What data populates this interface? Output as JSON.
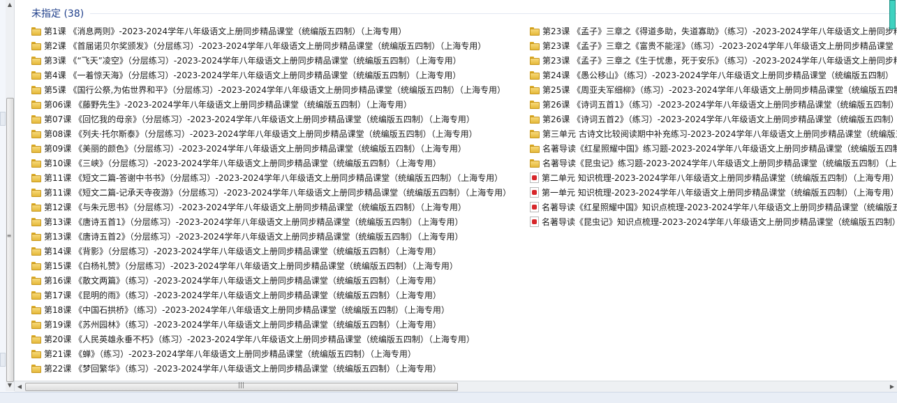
{
  "group": {
    "title": "未指定 (38)"
  },
  "column1": [
    {
      "icon": "folder-icon",
      "label": "第1课 《消息两则》-2023-2024学年八年级语文上册同步精品课堂（统编版五四制）（上海专用）"
    },
    {
      "icon": "folder-icon",
      "label": "第2课 《首届诺贝尔奖颁发》（分层练习）-2023-2024学年八年级语文上册同步精品课堂（统编版五四制）（上海专用）"
    },
    {
      "icon": "folder-icon",
      "label": "第3课 《“飞天”凌空》（分层练习）-2023-2024学年八年级语文上册同步精品课堂（统编版五四制）（上海专用）"
    },
    {
      "icon": "folder-icon",
      "label": "第4课 《一着惊天海》（分层练习）-2023-2024学年八年级语文上册同步精品课堂（统编版五四制）（上海专用）"
    },
    {
      "icon": "folder-icon",
      "label": "第5课 《国行公祭,为佑世界和平》（分层练习）-2023-2024学年八年级语文上册同步精品课堂（统编版五四制）（上海专用）"
    },
    {
      "icon": "folder-icon",
      "label": "第06课 《藤野先生》-2023-2024学年八年级语文上册同步精品课堂（统编版五四制）（上海专用）"
    },
    {
      "icon": "folder-icon",
      "label": "第07课 《回忆我的母亲》（分层练习）-2023-2024学年八年级语文上册同步精品课堂（统编版五四制）（上海专用）"
    },
    {
      "icon": "folder-icon",
      "label": "第08课 《列夫·托尔斯泰》（分层练习）-2023-2024学年八年级语文上册同步精品课堂（统编版五四制）（上海专用）"
    },
    {
      "icon": "folder-icon",
      "label": "第09课 《美丽的颜色》（分层练习）-2023-2024学年八年级语文上册同步精品课堂（统编版五四制）（上海专用）"
    },
    {
      "icon": "folder-icon",
      "label": "第10课 《三峡》（分层练习）-2023-2024学年八年级语文上册同步精品课堂（统编版五四制）（上海专用）"
    },
    {
      "icon": "folder-icon",
      "label": "第11课 《短文二篇-答谢中书书》（分层练习）-2023-2024学年八年级语文上册同步精品课堂（统编版五四制）（上海专用）"
    },
    {
      "icon": "folder-icon",
      "label": "第11课 《短文二篇-记承天寺夜游》（分层练习）-2023-2024学年八年级语文上册同步精品课堂（统编版五四制）（上海专用）"
    },
    {
      "icon": "folder-icon",
      "label": "第12课 《与朱元思书》（分层练习）-2023-2024学年八年级语文上册同步精品课堂（统编版五四制）（上海专用）"
    },
    {
      "icon": "folder-icon",
      "label": "第13课 《唐诗五首1》（分层练习）-2023-2024学年八年级语文上册同步精品课堂（统编版五四制）（上海专用）"
    },
    {
      "icon": "folder-icon",
      "label": "第13课 《唐诗五首2》（分层练习）-2023-2024学年八年级语文上册同步精品课堂（统编版五四制）（上海专用）"
    },
    {
      "icon": "folder-icon",
      "label": "第14课 《背影》（分层练习）-2023-2024学年八年级语文上册同步精品课堂（统编版五四制）（上海专用）"
    },
    {
      "icon": "folder-icon",
      "label": "第15课 《白杨礼赞》（分层练习）-2023-2024学年八年级语文上册同步精品课堂（统编版五四制）（上海专用）"
    },
    {
      "icon": "folder-icon",
      "label": "第16课 《散文两篇》（练习）-2023-2024学年八年级语文上册同步精品课堂（统编版五四制）（上海专用）"
    },
    {
      "icon": "folder-icon",
      "label": "第17课 《昆明的雨》（练习）-2023-2024学年八年级语文上册同步精品课堂（统编版五四制）（上海专用）"
    },
    {
      "icon": "folder-icon",
      "label": "第18课 《中国石拱桥》（练习）-2023-2024学年八年级语文上册同步精品课堂（统编版五四制）（上海专用）"
    },
    {
      "icon": "folder-icon",
      "label": "第19课 《苏州园林》（练习）-2023-2024学年八年级语文上册同步精品课堂（统编版五四制）（上海专用）"
    },
    {
      "icon": "folder-icon",
      "label": "第20课 《人民英雄永垂不朽》（练习）-2023-2024学年八年级语文上册同步精品课堂（统编版五四制）（上海专用）"
    },
    {
      "icon": "folder-icon",
      "label": "第21课 《蝉》（练习）-2023-2024学年八年级语文上册同步精品课堂（统编版五四制）（上海专用）"
    },
    {
      "icon": "folder-icon",
      "label": "第22课 《梦回繁华》（练习）-2023-2024学年八年级语文上册同步精品课堂（统编版五四制）（上海专用）"
    }
  ],
  "column2": [
    {
      "icon": "folder-icon",
      "label": "第23课 《孟子》三章之《得道多助，失道寡助》（练习）-2023-2024学年八年级语文上册同步精"
    },
    {
      "icon": "folder-icon",
      "label": "第23课 《孟子》三章之《富贵不能淫》（练习）-2023-2024学年八年级语文上册同步精品课堂"
    },
    {
      "icon": "folder-icon",
      "label": "第23课 《孟子》三章之《生于忧患，死于安乐》（练习）-2023-2024学年八年级语文上册同步精品"
    },
    {
      "icon": "folder-icon",
      "label": "第24课 《愚公移山》（练习）-2023-2024学年八年级语文上册同步精品课堂（统编版五四制）"
    },
    {
      "icon": "folder-icon",
      "label": "第25课 《周亚夫军细柳》（练习）-2023-2024学年八年级语文上册同步精品课堂（统编版五四制"
    },
    {
      "icon": "folder-icon",
      "label": "第26课 《诗词五首1》（练习）-2023-2024学年八年级语文上册同步精品课堂（统编版五四制）"
    },
    {
      "icon": "folder-icon",
      "label": "第26课 《诗词五首2》（练习）-2023-2024学年八年级语文上册同步精品课堂（统编版五四制）"
    },
    {
      "icon": "folder-icon",
      "label": "第三单元 古诗文比较阅读期中补充练习-2023-2024学年八年级语文上册同步精品课堂（统编版五"
    },
    {
      "icon": "folder-icon",
      "label": "名著导读《红星照耀中国》练习题-2023-2024学年八年级语文上册同步精品课堂（统编版五四制"
    },
    {
      "icon": "folder-icon",
      "label": "名著导读《昆虫记》练习题-2023-2024学年八年级语文上册同步精品课堂（统编版五四制）（上"
    },
    {
      "icon": "pdf-icon",
      "label": "第二单元 知识梳理-2023-2024学年八年级语文上册同步精品课堂（统编版五四制）（上海专用）"
    },
    {
      "icon": "pdf-icon",
      "label": "第一单元 知识梳理-2023-2024学年八年级语文上册同步精品课堂（统编版五四制）（上海专用）"
    },
    {
      "icon": "pdf-icon",
      "label": "名著导读《红星照耀中国》知识点梳理-2023-2024学年八年级语文上册同步精品课堂（统编版五"
    },
    {
      "icon": "pdf-icon",
      "label": "名著导读《昆虫记》知识点梳理-2023-2024学年八年级语文上册同步精品课堂（统编版五四制）"
    }
  ],
  "scrollbars": {
    "up": "▲",
    "down": "▼",
    "left": "◀",
    "right": "▶",
    "vgrip": "≡",
    "hgrip": "|||"
  }
}
